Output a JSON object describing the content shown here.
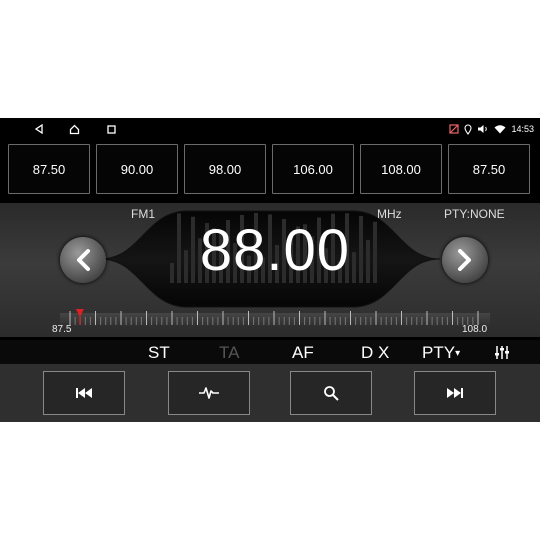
{
  "status": {
    "time": "14:53",
    "icons": [
      "settings-icon",
      "location-icon",
      "volume-icon",
      "wifi-icon"
    ],
    "nav": [
      "back-icon",
      "home-icon",
      "recent-apps-icon"
    ]
  },
  "presets": [
    "87.50",
    "90.00",
    "98.00",
    "106.00",
    "108.00",
    "87.50"
  ],
  "tuner": {
    "band": "FM1",
    "frequency": "88.00",
    "unit": "MHz",
    "pty": "PTY:NONE",
    "scale_min_label": "87.5",
    "scale_max_label": "108.0",
    "scale_min": 87.5,
    "scale_max": 108.0,
    "current": 88.0
  },
  "functions": {
    "st": "ST",
    "ta": "TA",
    "af": "AF",
    "dx": "D X",
    "pty": "PTY",
    "pty_arrow": "▾"
  },
  "controls": [
    "prev-track-icon",
    "waveform-icon",
    "search-icon",
    "next-track-icon"
  ],
  "colors": {
    "screen_bg": "#000000",
    "indicator": "#e02020",
    "ta_disabled": "#555555",
    "text": "#ffffff"
  }
}
